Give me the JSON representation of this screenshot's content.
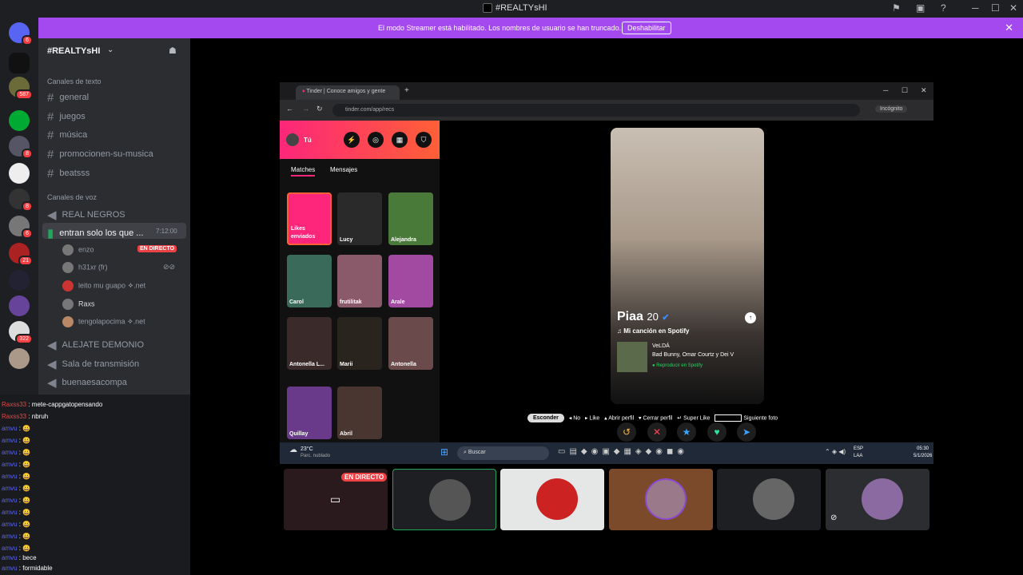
{
  "window": {
    "title": "#REALTYsHI"
  },
  "banner": {
    "message": "El modo Streamer está habilitado. Los nombres de usuario se han truncado.",
    "button": "Deshabilitar"
  },
  "servers": {
    "badges": [
      "6",
      "587",
      "8",
      "8",
      "6",
      "21",
      "322"
    ]
  },
  "sidebar": {
    "server_name": "#REALTYsHI",
    "text_category": "Canales de texto",
    "text_channels": [
      "general",
      "juegos",
      "música",
      "promocionen-su-musica",
      "beatsss"
    ],
    "voice_category": "Canales de voz",
    "voice_channels": [
      "REAL NEGROS",
      "entran solo los que ...",
      "ALEJATE DEMONIO",
      "Sala de transmisión",
      "buenaesacompa"
    ],
    "active_channel_time": "7:12:00",
    "voice_users": [
      {
        "name": "enzo",
        "tag": "EN DIRECTO"
      },
      {
        "name": "h31xr (fr)",
        "tag": ""
      },
      {
        "name": "leito mu guapo",
        "tag": ".net"
      },
      {
        "name": "Raxs",
        "tag": ""
      },
      {
        "name": "tengolapocima",
        "tag": ".net"
      }
    ]
  },
  "chat": {
    "lines": [
      {
        "user": "Raxss33",
        "text": "mete-cappgatopensando"
      },
      {
        "user": "Raxss33",
        "text": "nbruh"
      },
      {
        "user": "amvu",
        "text": ""
      },
      {
        "user": "amvu",
        "text": ""
      },
      {
        "user": "amvu",
        "text": ""
      },
      {
        "user": "amvu",
        "text": ""
      },
      {
        "user": "amvu",
        "text": ""
      },
      {
        "user": "amvu",
        "text": ""
      },
      {
        "user": "amvu",
        "text": ""
      },
      {
        "user": "amvu",
        "text": ""
      },
      {
        "user": "amvu",
        "text": ""
      },
      {
        "user": "amvu",
        "text": ""
      },
      {
        "user": "amvu",
        "text": ""
      },
      {
        "user": "amvu",
        "text": "bece"
      },
      {
        "user": "amvu",
        "text": "formidable"
      }
    ]
  },
  "browser": {
    "tab": "Tinder | Conoce amigos y gente",
    "url": "tinder.com/app/recs",
    "incognito": "Incógnito"
  },
  "tinder": {
    "user": "Tú",
    "tabs": [
      "Matches",
      "Mensajes"
    ],
    "likes_label": "Likes enviados",
    "matches": [
      "Lucy",
      "Alejandra",
      "Carol",
      "frutilitak",
      "Arale",
      "Antonella L...",
      "Marii",
      "Antonella",
      "Quillay",
      "Abril"
    ],
    "profile": {
      "name": "Piaa",
      "age": "20",
      "anthem_label": "Mi canción en Spotify",
      "song": "VeLDÁ",
      "artists": "Bad Bunny, Omar Courtz y Dei V",
      "play": "Reproducir en Spotify"
    },
    "shortcuts": [
      "Esconder",
      "No",
      "Like",
      "Abrir perfil",
      "Cerrar perfil",
      "Super Like",
      "Siguiente foto"
    ]
  },
  "taskbar": {
    "weather_temp": "23°C",
    "weather_desc": "Parc. nublado",
    "search": "Buscar",
    "lang": "ESP",
    "region": "LAA",
    "time": "05:30",
    "date": "5/1/2026"
  },
  "thumbs": {
    "live": "EN DIRECTO"
  },
  "colors": {
    "streamer": "#a448f0",
    "tinder_gradient_start": "#fd267a",
    "tinder_gradient_end": "#ff6036",
    "live": "#ed4245"
  }
}
